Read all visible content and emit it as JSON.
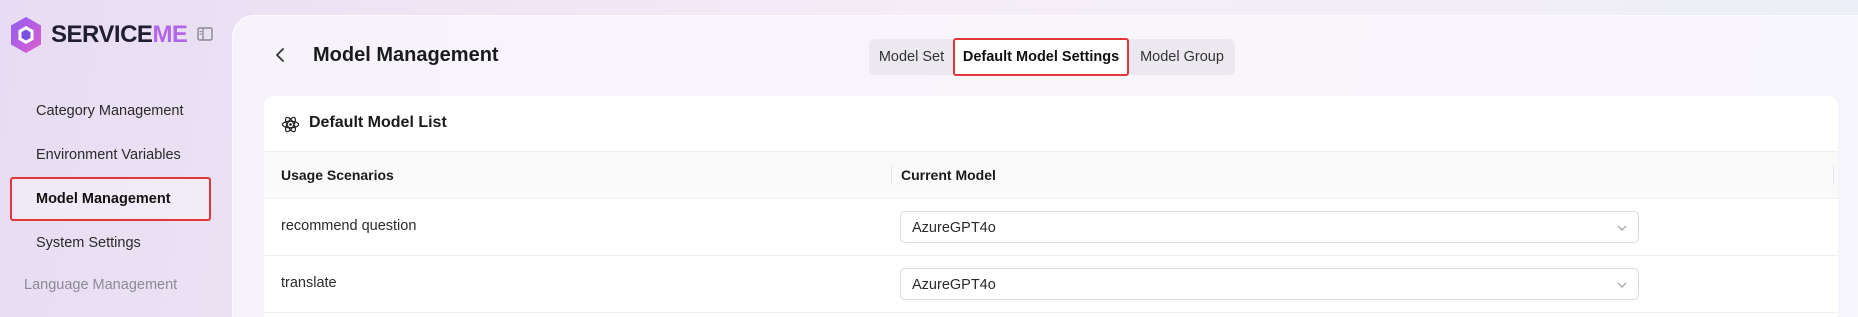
{
  "brand": {
    "name_prefix": "SERVICE",
    "name_suffix": "ME",
    "accent": "#b266e8"
  },
  "sidebar": {
    "items": [
      {
        "label": "Category Management"
      },
      {
        "label": "Environment Variables"
      },
      {
        "label": "Model Management",
        "active": true
      },
      {
        "label": "System Settings"
      }
    ],
    "section_label": "Language Management"
  },
  "header": {
    "title": "Model Management",
    "tabs": [
      {
        "label": "Model Set"
      },
      {
        "label": "Default Model Settings",
        "active": true
      },
      {
        "label": "Model Group"
      }
    ]
  },
  "card": {
    "title": "Default Model List",
    "columns": [
      "Usage Scenarios",
      "Current Model"
    ],
    "rows": [
      {
        "scenario": "recommend question",
        "model": "AzureGPT4o"
      },
      {
        "scenario": "translate",
        "model": "AzureGPT4o"
      }
    ]
  },
  "colors": {
    "highlight": "#e0373b",
    "background": "#efe6f5"
  }
}
